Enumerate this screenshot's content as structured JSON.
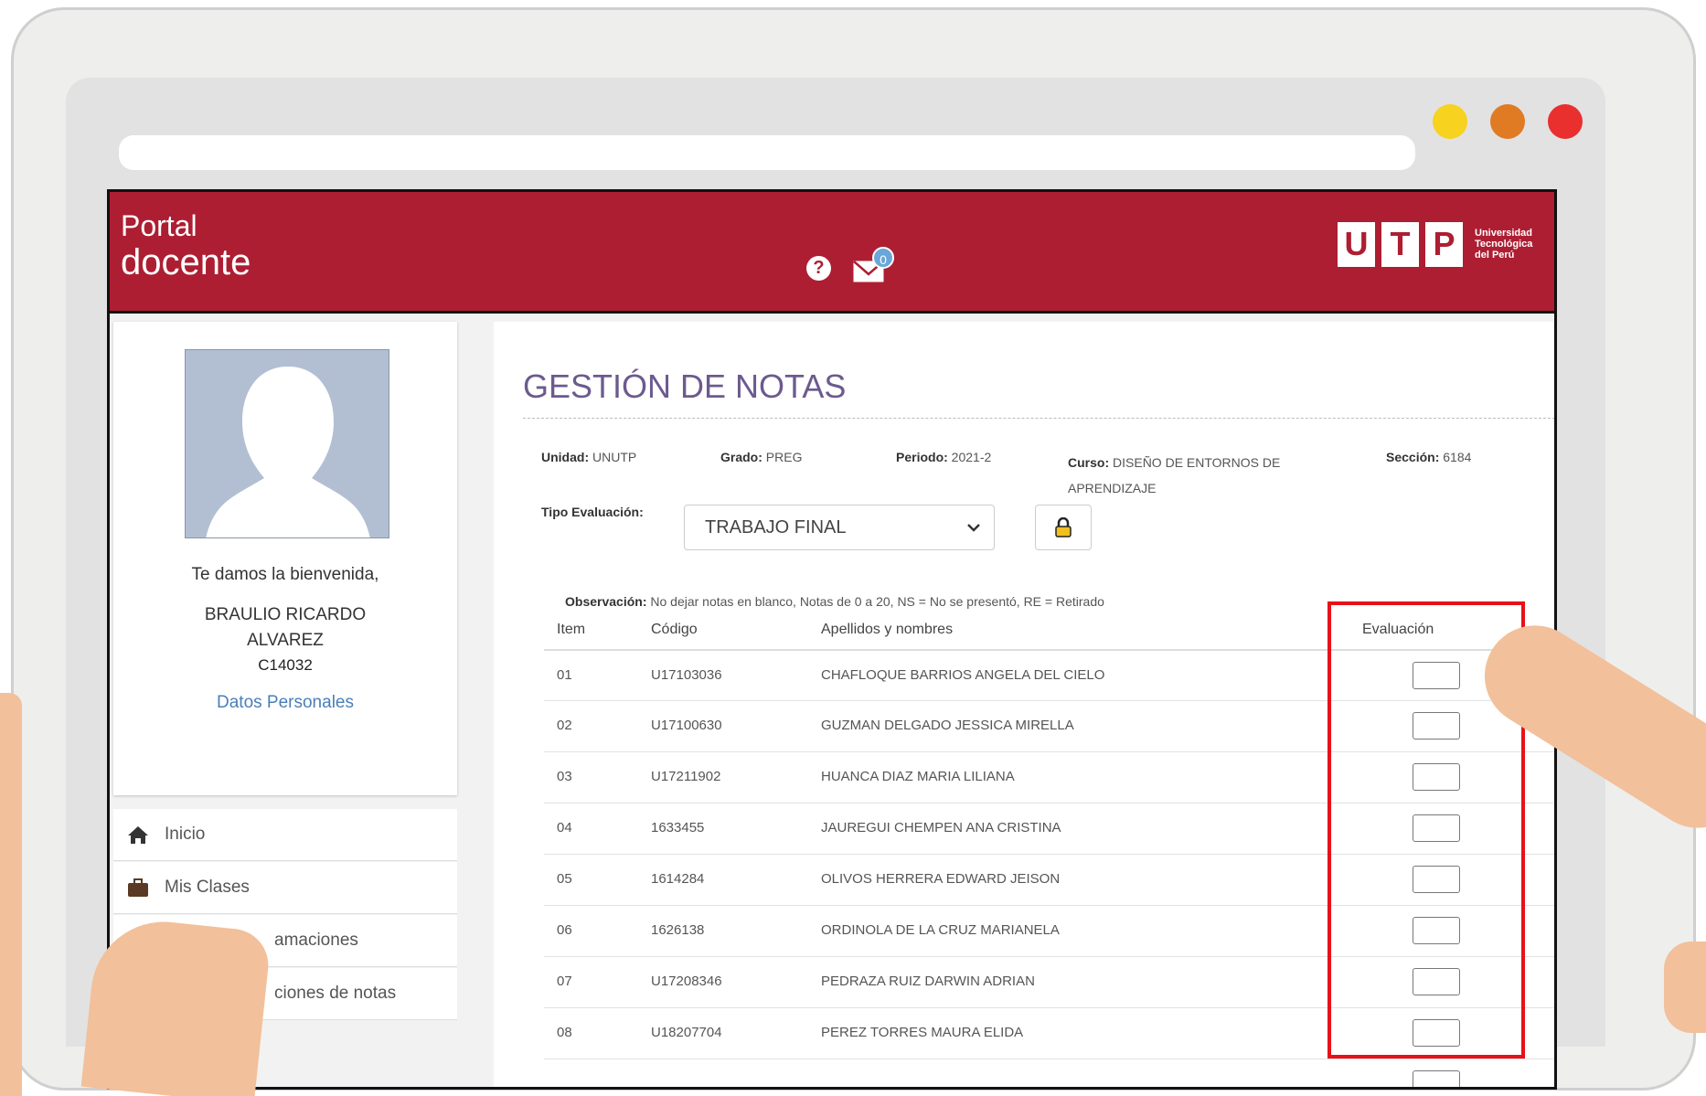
{
  "header": {
    "title_line1": "Portal",
    "title_line2": "docente",
    "help_icon": "question-circle-icon",
    "mail_icon": "mail-icon",
    "mail_count": "0",
    "logo_letters": [
      "U",
      "T",
      "P"
    ],
    "logo_text": [
      "Universidad",
      "Tecnológica",
      "del Perú"
    ]
  },
  "profile": {
    "welcome": "Te damos la bienvenida,",
    "name_line1": "BRAULIO RICARDO",
    "name_line2": "ALVAREZ",
    "code": "C14032",
    "personal_data_link": "Datos Personales"
  },
  "menu": [
    {
      "label": "Inicio",
      "icon": "home-icon"
    },
    {
      "label": "Mis Clases",
      "icon": "briefcase-icon"
    },
    {
      "label": "amaciones",
      "icon": "clock-icon"
    },
    {
      "label": "ciones de notas",
      "icon": "document-icon"
    }
  ],
  "main": {
    "title": "GESTIÓN DE NOTAS",
    "unidad_label": "Unidad:",
    "unidad_value": "UNUTP",
    "grado_label": "Grado:",
    "grado_value": "PREG",
    "periodo_label": "Periodo:",
    "periodo_value": "2021-2",
    "curso_label": "Curso:",
    "curso_value_line1": "DISEÑO DE ENTORNOS DE",
    "curso_value_line2": "APRENDIZAJE",
    "seccion_label": "Sección:",
    "seccion_value": "6184",
    "tipo_label": "Tipo Evaluación:",
    "tipo_selected": "TRABAJO FINAL",
    "lock_icon": "lock-icon",
    "obs_label": "Observación:",
    "obs_text": "No dejar notas en blanco, Notas de 0 a 20, NS = No se presentó, RE = Retirado"
  },
  "table": {
    "headers": {
      "item": "Item",
      "codigo": "Código",
      "nombres": "Apellidos y nombres",
      "evaluacion": "Evaluación"
    },
    "rows": [
      {
        "item": "01",
        "codigo": "U17103036",
        "nombre": "CHAFLOQUE BARRIOS ANGELA DEL CIELO"
      },
      {
        "item": "02",
        "codigo": "U17100630",
        "nombre": "GUZMAN DELGADO JESSICA MIRELLA"
      },
      {
        "item": "03",
        "codigo": "U17211902",
        "nombre": "HUANCA DIAZ MARIA LILIANA"
      },
      {
        "item": "04",
        "codigo": "1633455",
        "nombre": "JAUREGUI CHEMPEN ANA CRISTINA"
      },
      {
        "item": "05",
        "codigo": "1614284",
        "nombre": "OLIVOS HERRERA EDWARD JEISON"
      },
      {
        "item": "06",
        "codigo": "1626138",
        "nombre": "ORDINOLA DE LA CRUZ MARIANELA"
      },
      {
        "item": "07",
        "codigo": "U17208346",
        "nombre": "PEDRAZA RUIZ DARWIN ADRIAN"
      },
      {
        "item": "08",
        "codigo": "U18207704",
        "nombre": "PEREZ TORRES MAURA ELIDA"
      }
    ]
  },
  "colors": {
    "header_red": "#ad1e32",
    "title_purple": "#6c5a8f",
    "highlight_red": "#e8111a",
    "dot_yellow": "#f7d21e",
    "dot_orange": "#e07b24",
    "dot_red": "#ea2f2f"
  }
}
